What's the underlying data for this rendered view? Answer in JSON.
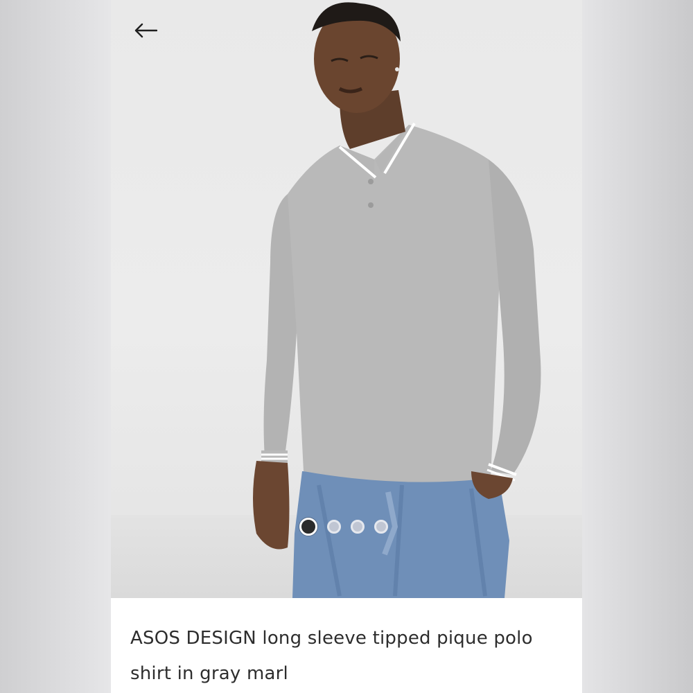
{
  "app": {
    "screen": "product-detail"
  },
  "navigation": {
    "back_icon": "arrow-left-icon"
  },
  "gallery": {
    "image_subject": "product-photo",
    "slide_count": 4,
    "active_slide": 1,
    "dot_colors": {
      "active": "#2b2b2b",
      "inactive": "#c9ccd6"
    }
  },
  "product": {
    "title": "ASOS DESIGN long sleeve tipped pique polo shirt in gray marl"
  }
}
